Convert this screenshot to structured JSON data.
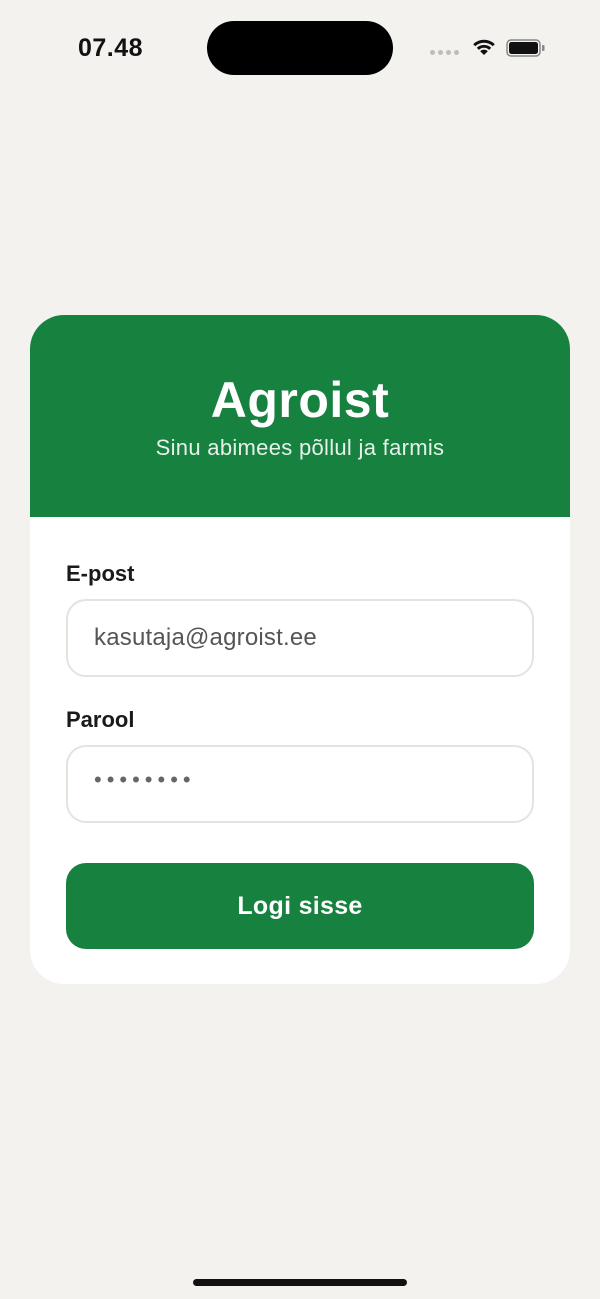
{
  "status_bar": {
    "time": "07.48",
    "icons": [
      "signal-dots-icon",
      "wifi-icon",
      "battery-icon"
    ]
  },
  "card": {
    "title": "Agroist",
    "subtitle": "Sinu abimees põllul ja farmis",
    "email_label": "E-post",
    "email_value": "kasutaja@agroist.ee",
    "password_label": "Parool",
    "password_value": "••••••••",
    "login_button": "Logi sisse"
  },
  "colors": {
    "brand_green": "#178240",
    "background": "#f4f2ee",
    "card_background": "#ffffff",
    "input_border": "#e6e3dd"
  }
}
